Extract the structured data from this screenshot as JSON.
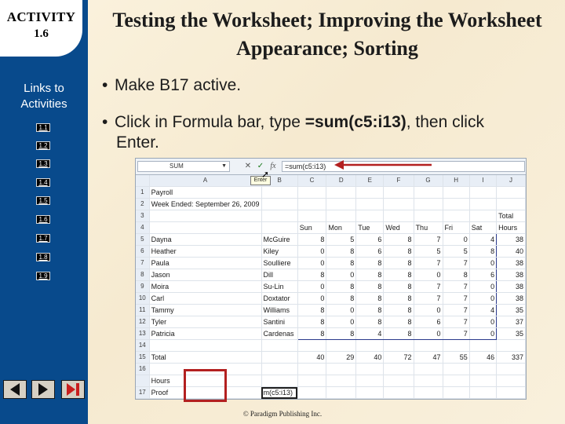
{
  "activity": {
    "label": "ACTIVITY",
    "number": "1.6"
  },
  "title": "Testing the Worksheet; Improving the Worksheet Appearance; Sorting",
  "links_heading": "Links to Activities",
  "nav_links": [
    "1.1",
    "1.2",
    "1.3",
    "1.4",
    "1.5",
    "1.6",
    "1.7",
    "1.8",
    "1.9"
  ],
  "controls": {
    "back": "back-to-start",
    "next": "next-slide",
    "end": "end-show"
  },
  "bullets": [
    {
      "text": "Make B17 active."
    },
    {
      "pre": "Click in Formula bar, type ",
      "bold": "=sum(c5:i13)",
      "post": ", then click",
      "line2": "Enter."
    }
  ],
  "spreadsheet": {
    "name_box": "SUM",
    "formula": "=sum(c5:i13)",
    "tooltip": "Enter",
    "columns": [
      "A",
      "B",
      "C",
      "D",
      "E",
      "F",
      "G",
      "H",
      "I",
      "J"
    ],
    "rows": [
      {
        "n": "1",
        "cells": [
          "Payroll",
          "",
          "",
          "",
          "",
          "",
          "",
          "",
          "",
          ""
        ]
      },
      {
        "n": "2",
        "cells": [
          "Week Ended: September 26, 2009",
          "",
          "",
          "",
          "",
          "",
          "",
          "",
          "",
          ""
        ]
      },
      {
        "n": "3",
        "cells": [
          "",
          "",
          "",
          "",
          "",
          "",
          "",
          "",
          "",
          "Total"
        ]
      },
      {
        "n": "4",
        "cells": [
          "",
          "",
          "Sun",
          "Mon",
          "Tue",
          "Wed",
          "Thu",
          "Fri",
          "Sat",
          "Hours"
        ]
      },
      {
        "n": "5",
        "cells": [
          "Dayna",
          "McGuire",
          "8",
          "5",
          "6",
          "8",
          "7",
          "0",
          "4",
          "38"
        ]
      },
      {
        "n": "6",
        "cells": [
          "Heather",
          "Kiley",
          "0",
          "8",
          "6",
          "8",
          "5",
          "5",
          "8",
          "40"
        ]
      },
      {
        "n": "7",
        "cells": [
          "Paula",
          "Soulliere",
          "0",
          "8",
          "8",
          "8",
          "7",
          "7",
          "0",
          "38"
        ]
      },
      {
        "n": "8",
        "cells": [
          "Jason",
          "Dill",
          "8",
          "0",
          "8",
          "8",
          "0",
          "8",
          "6",
          "38"
        ]
      },
      {
        "n": "9",
        "cells": [
          "Moira",
          "Su-Lin",
          "0",
          "8",
          "8",
          "8",
          "7",
          "7",
          "0",
          "38"
        ]
      },
      {
        "n": "10",
        "cells": [
          "Carl",
          "Doxtator",
          "0",
          "8",
          "8",
          "8",
          "7",
          "7",
          "0",
          "38"
        ]
      },
      {
        "n": "11",
        "cells": [
          "Tammy",
          "Williams",
          "8",
          "0",
          "8",
          "8",
          "0",
          "7",
          "4",
          "35"
        ]
      },
      {
        "n": "12",
        "cells": [
          "Tyler",
          "Santini",
          "8",
          "0",
          "8",
          "8",
          "6",
          "7",
          "0",
          "37"
        ]
      },
      {
        "n": "13",
        "cells": [
          "Patricia",
          "Cardenas",
          "8",
          "8",
          "4",
          "8",
          "0",
          "7",
          "0",
          "35"
        ]
      },
      {
        "n": "14",
        "cells": [
          "",
          "",
          "",
          "",
          "",
          "",
          "",
          "",
          "",
          ""
        ]
      },
      {
        "n": "15",
        "cells": [
          "Total",
          "",
          "40",
          "29",
          "40",
          "72",
          "47",
          "55",
          "46",
          "337"
        ]
      },
      {
        "n": "16",
        "cells": [
          "",
          "",
          "",
          "",
          "",
          "",
          "",
          "",
          "",
          ""
        ]
      },
      {
        "n": "16b",
        "cells": [
          "Hours",
          "",
          "",
          "",
          "",
          "",
          "",
          "",
          "",
          ""
        ]
      },
      {
        "n": "17",
        "cells": [
          "Proof",
          "m(c5:i13)",
          "",
          "",
          "",
          "",
          "",
          "",
          "",
          ""
        ]
      }
    ]
  },
  "copyright": "© Paradigm Publishing Inc."
}
